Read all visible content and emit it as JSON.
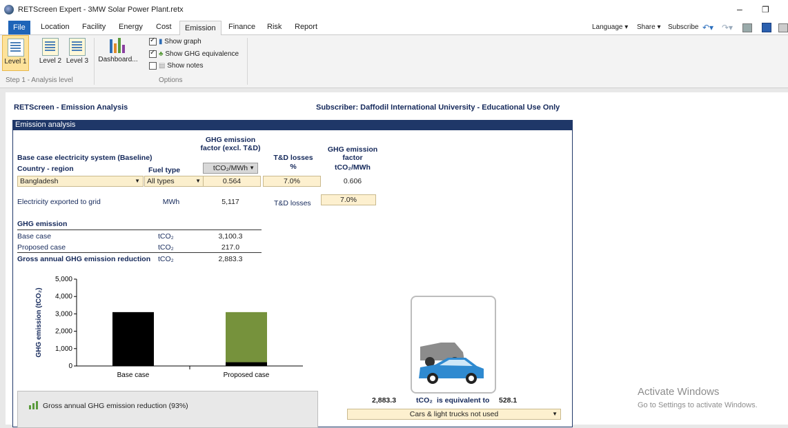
{
  "window": {
    "title": "RETScreen Expert - 3MW Solar Power Plant.retx",
    "minimize": "–",
    "restore": "❐"
  },
  "menu": {
    "tabs": [
      "File",
      "Location",
      "Facility",
      "Energy",
      "Cost",
      "Emission",
      "Finance",
      "Risk",
      "Report"
    ],
    "active": "Emission",
    "right": {
      "language": "Language ▾",
      "share": "Share ▾",
      "subscribe": "Subscribe"
    }
  },
  "ribbon": {
    "levels": [
      "Level 1",
      "Level 2",
      "Level 3"
    ],
    "dashboard": "Dashboard...",
    "step_label": "Step 1 - Analysis level",
    "options_label": "Options",
    "show_graph": "Show graph",
    "show_ghg": "Show GHG equivalence",
    "show_notes": "Show notes"
  },
  "sheet": {
    "heading": "RETScreen - Emission Analysis",
    "subscriber": "Subscriber: Daffodil International University - Educational Use Only",
    "section_title": "Emission analysis",
    "baseline": {
      "title": "Base case electricity system (Baseline)",
      "country_label": "Country - region",
      "fuel_type_label": "Fuel type",
      "ghg_factor_header": "GHG emission factor (excl. T&D)",
      "ghg_factor_unit": "tCO₂/MWh",
      "td_losses_header": "T&D losses",
      "td_losses_unit": "%",
      "ghg_factor2_header": "GHG emission factor",
      "ghg_factor2_unit": "tCO₂/MWh",
      "country": "Bangladesh",
      "fuel_type": "All types",
      "factor": "0.564",
      "td_losses": "7.0%",
      "factor2": "0.606"
    },
    "export": {
      "label": "Electricity exported to grid",
      "unit": "MWh",
      "value": "5,117",
      "td_label": "T&D losses",
      "td_value": "7.0%"
    },
    "ghg": {
      "title": "GHG emission",
      "rows": [
        {
          "label": "Base case",
          "unit": "tCO₂",
          "value": "3,100.3"
        },
        {
          "label": "Proposed case",
          "unit": "tCO₂",
          "value": "217.0"
        },
        {
          "label": "Gross annual GHG emission reduction",
          "unit": "tCO₂",
          "value": "2,883.3"
        }
      ]
    },
    "equivalence": {
      "value": "2,883.3",
      "unit": "tCO₂",
      "text": "is equivalent to",
      "result": "528.1",
      "dropdown": "Cars & light trucks not used"
    },
    "reduction_legend": "Gross annual GHG emission reduction (93%)",
    "activate": {
      "title": "Activate Windows",
      "sub": "Go to Settings to activate Windows."
    }
  },
  "chart_data": {
    "type": "bar",
    "ylabel": "GHG emission (tCO₂)",
    "ylim": [
      0,
      5000
    ],
    "yticks": [
      "5,000",
      "4,000",
      "3,000",
      "2,000",
      "1,000",
      "0"
    ],
    "categories": [
      "Base case",
      "Proposed case"
    ],
    "series": [
      {
        "values": [
          3100.3,
          217.0
        ],
        "color": "#000000"
      },
      {
        "values": [
          0,
          2883.3
        ],
        "color": "#76923c"
      }
    ]
  }
}
